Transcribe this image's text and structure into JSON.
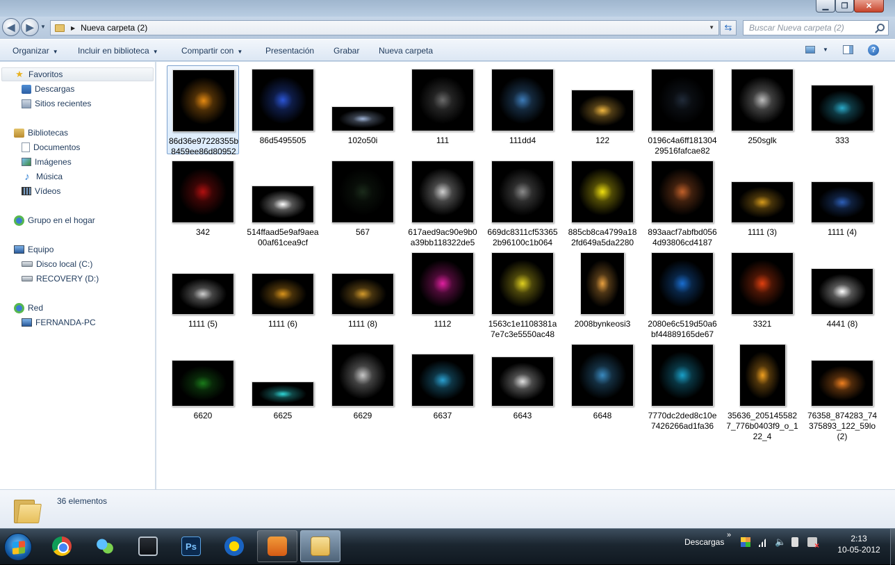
{
  "window": {
    "controls": {
      "minimize": "▁",
      "maximize": "❐",
      "close": "✕"
    }
  },
  "nav": {
    "back_icon": "◀",
    "forward_icon": "▶",
    "address_arrow": "▶",
    "address": "Nueva carpeta (2)",
    "search_placeholder": "Buscar Nueva carpeta (2)"
  },
  "toolbar": {
    "organize": "Organizar",
    "include_library": "Incluir en biblioteca",
    "share": "Compartir con",
    "slideshow": "Presentación",
    "burn": "Grabar",
    "new_folder": "Nueva carpeta"
  },
  "sidebar": {
    "favorites": "Favoritos",
    "downloads": "Descargas",
    "recent": "Sitios recientes",
    "libraries": "Bibliotecas",
    "documents": "Documentos",
    "images": "Imágenes",
    "music": "Música",
    "videos": "Vídeos",
    "homegroup": "Grupo en el hogar",
    "computer": "Equipo",
    "local_disk": "Disco local (C:)",
    "recovery": "RECOVERY (D:)",
    "network": "Red",
    "network_pc": "FERNANDA-PC"
  },
  "files": [
    {
      "name": "86d36e97228355b8459ee86d80952",
      "accent": "#e58a12"
    },
    {
      "name": "86d5495505",
      "accent": "#2b55d6"
    },
    {
      "name": "102o50i",
      "accent": "#9fb4d8"
    },
    {
      "name": "111",
      "accent": "#6a6a6a"
    },
    {
      "name": "111dd4",
      "accent": "#3d7bb8"
    },
    {
      "name": "122",
      "accent": "#f0b640"
    },
    {
      "name": "0196c4a6ff18130429516fafcae82",
      "accent": "#202a38"
    },
    {
      "name": "250sglk",
      "accent": "#bdbdbd"
    },
    {
      "name": "333",
      "accent": "#2aa9c8"
    },
    {
      "name": "342",
      "accent": "#b11010"
    },
    {
      "name": "514ffaad5e9af9aea00af61cea9cf",
      "accent": "#ffffff"
    },
    {
      "name": "567",
      "accent": "#1a2a1a"
    },
    {
      "name": "617aed9ac90e9b0a39bb118322de5",
      "accent": "#cfcfcf"
    },
    {
      "name": "669dc8311cf533652b96100c1b064",
      "accent": "#8a8a8a"
    },
    {
      "name": "885cb8ca4799a182fd649a5da2280",
      "accent": "#f0e010"
    },
    {
      "name": "893aacf7abfbd0564d93806cd4187",
      "accent": "#c0602a"
    },
    {
      "name": "1111 (3)",
      "accent": "#d59a1c"
    },
    {
      "name": "1111 (4)",
      "accent": "#2d5fb8"
    },
    {
      "name": "1111 (5)",
      "accent": "#cfcfcf"
    },
    {
      "name": "1111 (6)",
      "accent": "#d9941c"
    },
    {
      "name": "1111 (8)",
      "accent": "#d39a2c"
    },
    {
      "name": "1112",
      "accent": "#e020a0"
    },
    {
      "name": "1563c1e1108381a7e7c3e5550ac48",
      "accent": "#e0d020"
    },
    {
      "name": "2008bynkeosi3",
      "accent": "#e8a040"
    },
    {
      "name": "2080e6c519d50a6bf44889165de67",
      "accent": "#1a6ed0"
    },
    {
      "name": "3321",
      "accent": "#e04010"
    },
    {
      "name": "4441 (8)",
      "accent": "#ffffff"
    },
    {
      "name": "6620",
      "accent": "#1a7a1a"
    },
    {
      "name": "6625",
      "accent": "#30d8d8"
    },
    {
      "name": "6629",
      "accent": "#c8c8c8"
    },
    {
      "name": "6637",
      "accent": "#2aa0d0"
    },
    {
      "name": "6643",
      "accent": "#e0e0e0"
    },
    {
      "name": "6648",
      "accent": "#3a8ac0"
    },
    {
      "name": "7770dc2ded8c10e7426266ad1fa36",
      "accent": "#1aa0c8"
    },
    {
      "name": "35636_2051455827_776b0403f9_o_122_4",
      "accent": "#f0a020"
    },
    {
      "name": "76358_874283_74375893_122_59lo (2)",
      "accent": "#f08020"
    }
  ],
  "details": {
    "count": "36 elementos"
  },
  "taskbar": {
    "tray_label": "Descargas",
    "chevron": "»",
    "ps_label": "Ps",
    "time": "2:13",
    "date": "10-05-2012"
  }
}
